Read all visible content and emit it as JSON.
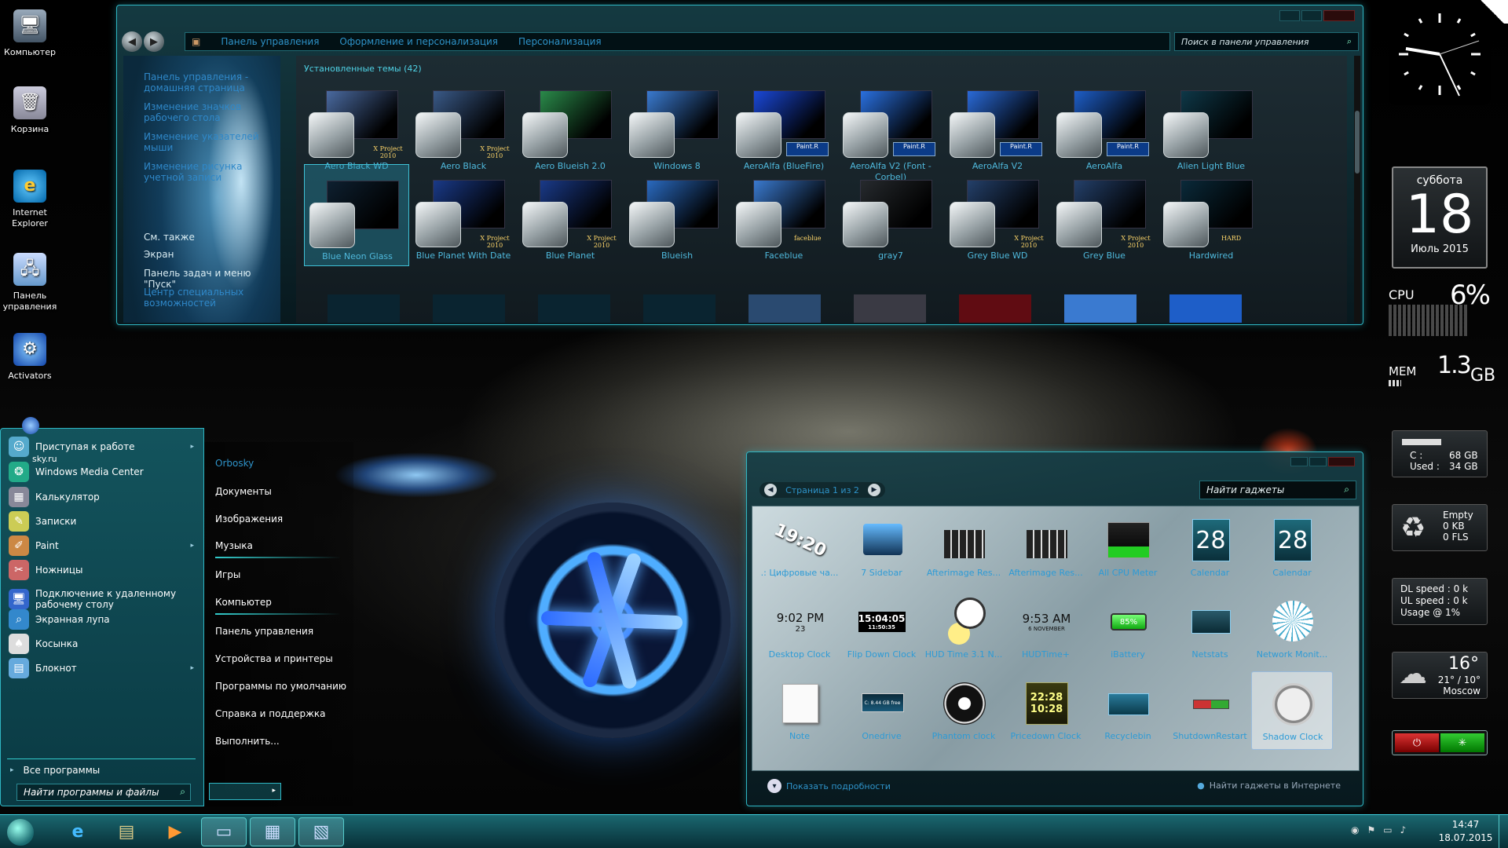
{
  "desktop_icons": [
    {
      "label": "Компьютер",
      "icon": "computer-icon"
    },
    {
      "label": "Корзина",
      "icon": "recycle-bin-icon"
    },
    {
      "label": "Internet Explorer",
      "icon": "ie-icon"
    },
    {
      "label": "Панель управления",
      "icon": "control-panel-icon"
    },
    {
      "label": "Activators",
      "icon": "activators-icon"
    }
  ],
  "control_panel": {
    "breadcrumb": [
      "Панель управления",
      "Оформление и персонализация",
      "Персонализация"
    ],
    "search_placeholder": "Поиск в панели управления",
    "side_links": [
      "Панель управления - домашняя страница",
      "Изменение значков рабочего стола",
      "Изменение указателей мыши",
      "Изменение рисунка учетной записи"
    ],
    "see_also_title": "См. также",
    "see_also": [
      "Экран",
      "Панель задач и меню \"Пуск\"",
      "Центр специальных возможностей"
    ],
    "themes_header": "Установленные темы (42)",
    "themes_row1": [
      {
        "name": "Aero Black WD",
        "tag": "X Project 2010",
        "color": "#4a6aa0"
      },
      {
        "name": "Aero Black",
        "tag": "X Project 2010",
        "color": "#3a5a88"
      },
      {
        "name": "Aero Blueish 2.0",
        "tag": "",
        "color": "#2a8a4a"
      },
      {
        "name": "Windows 8",
        "tag": "",
        "color": "#3a7ad0"
      },
      {
        "name": "AeroAlfa (BlueFire)",
        "tag": "Paint.R",
        "color": "#1a48d8"
      },
      {
        "name": "AeroAlfa V2 (Font - Corbel)",
        "tag": "Paint.R",
        "color": "#2a70e0"
      },
      {
        "name": "AeroAlfa V2",
        "tag": "Paint.R",
        "color": "#2a6ad8"
      },
      {
        "name": "AeroAlfa",
        "tag": "Paint.R",
        "color": "#1e5ec8"
      },
      {
        "name": "Alien Light Blue",
        "tag": "",
        "color": "#0e3848"
      }
    ],
    "themes_row2": [
      {
        "name": "Blue Neon Glass",
        "tag": "",
        "color": "#0e2030"
      },
      {
        "name": "Blue Planet With Date",
        "tag": "X Project 2010",
        "color": "#1a3a88"
      },
      {
        "name": "Blue Planet",
        "tag": "X Project 2010",
        "color": "#1a3a88"
      },
      {
        "name": "Blueish",
        "tag": "",
        "color": "#2a6ac0"
      },
      {
        "name": "Faceblue",
        "tag": "faceblue",
        "color": "#3a7ad0"
      },
      {
        "name": "gray7",
        "tag": "",
        "color": "#262a2e"
      },
      {
        "name": "Grey Blue WD",
        "tag": "X Project 2010",
        "color": "#24406a"
      },
      {
        "name": "Grey Blue",
        "tag": "X Project 2010",
        "color": "#24406a"
      },
      {
        "name": "Hardwired",
        "tag": "HARD",
        "color": "#0a2a3a"
      }
    ]
  },
  "start_menu": {
    "items": [
      "Приступая к работе",
      "Windows Media Center",
      "Калькулятор",
      "Записки",
      "Paint",
      "Ножницы",
      "Подключение к удаленному рабочему столу",
      "Экранная лупа",
      "Косынка",
      "Блокнот"
    ],
    "user_label": "sky.ru",
    "all_programs": "Все программы",
    "search_placeholder": "Найти программы и файлы",
    "right_items": [
      "Orbosky",
      "Документы",
      "Изображения",
      "Музыка",
      "Игры",
      "Компьютер",
      "Панель управления",
      "Устройства и принтеры",
      "Программы по умолчанию",
      "Справка и поддержка",
      "Выполнить..."
    ]
  },
  "gadgets": {
    "page_label": "Страница 1 из 2",
    "search_placeholder": "Найти гаджеты",
    "items": [
      {
        "name": ".: Цифровые ча...",
        "icon": "digital-clock-icon"
      },
      {
        "name": "7 Sidebar",
        "icon": "sidebar-icon"
      },
      {
        "name": "Afterimage Res...",
        "icon": "afterimage-icon"
      },
      {
        "name": "Afterimage Res...",
        "icon": "afterimage-icon"
      },
      {
        "name": "All CPU Meter",
        "icon": "cpu-meter-icon"
      },
      {
        "name": "Calendar",
        "icon": "calendar-icon"
      },
      {
        "name": "Calendar",
        "icon": "calendar-icon"
      },
      {
        "name": "Desktop Clock",
        "icon": "desktop-clock-icon"
      },
      {
        "name": "Flip Down Clock",
        "icon": "flip-clock-icon"
      },
      {
        "name": "HUD Time 3.1 N...",
        "icon": "hud-time-icon"
      },
      {
        "name": "HUDTime+",
        "icon": "hudtime-plus-icon"
      },
      {
        "name": "iBattery",
        "icon": "battery-icon"
      },
      {
        "name": "Netstats",
        "icon": "netstats-icon"
      },
      {
        "name": "Network Monit...",
        "icon": "network-monitor-icon"
      },
      {
        "name": "Note",
        "icon": "note-icon"
      },
      {
        "name": "Onedrive",
        "icon": "onedrive-icon"
      },
      {
        "name": "Phantom clock",
        "icon": "phantom-clock-icon"
      },
      {
        "name": "Pricedown Clock",
        "icon": "pricedown-clock-icon"
      },
      {
        "name": "Recyclebin",
        "icon": "recyclebin-icon"
      },
      {
        "name": "ShutdownRestart",
        "icon": "shutdown-icon"
      },
      {
        "name": "Shadow Clock",
        "icon": "shadow-clock-icon"
      }
    ],
    "clock_text_1": "19:20",
    "clock_text_2": "9:02 PM",
    "clock_text_2b": "23",
    "flip_time": "15:04:05",
    "flip_sub": "11:50:35",
    "hud_time": "9:53 AM",
    "hud_date": "6 NOVEMBER",
    "battery": "85%",
    "calendar_day": "28",
    "pricedown_1": "22:28",
    "pricedown_2": "10:28",
    "onedrive_text": "C: 8.44 GB free",
    "show_details": "Показать подробности",
    "find_online": "Найти гаджеты в Интернете"
  },
  "sidebar": {
    "date_weekday": "суббота",
    "date_day": "18",
    "date_month": "Июль 2015",
    "cpu_label": "CPU",
    "cpu_value": "6%",
    "mem_label": "MEM",
    "mem_value": "1.3",
    "mem_unit": "GB",
    "drive_c": "C :",
    "drive_c_size": "68 GB",
    "drive_used": "Used :",
    "drive_used_size": "34 GB",
    "recycle_1": "Empty",
    "recycle_2": "0 KB",
    "recycle_3": "0 FLS",
    "net_dl": "DL speed : 0 k",
    "net_ul": "UL speed : 0 k",
    "net_usage": "Usage @ 1%",
    "weather_temp": "16°",
    "weather_range": "21° / 10°",
    "weather_city": "Moscow"
  },
  "taskbar": {
    "time": "14:47",
    "date": "18.07.2015"
  },
  "colors": {
    "accent": "#2fb6c3",
    "link": "#2e93c9"
  }
}
